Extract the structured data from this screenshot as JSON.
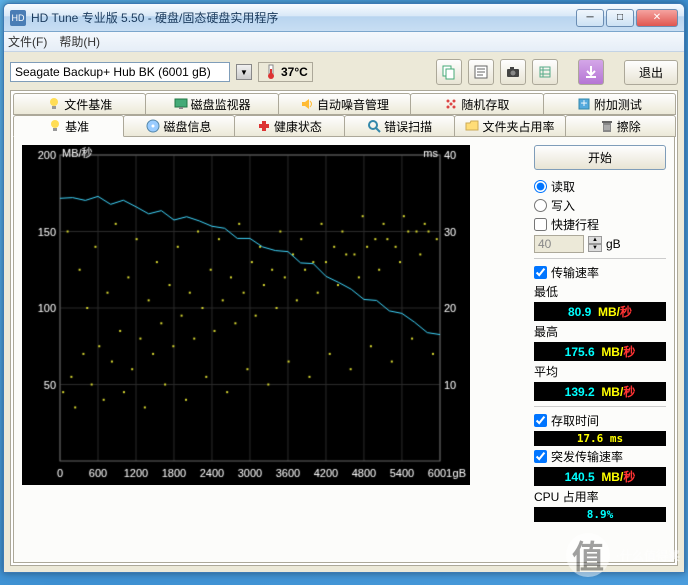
{
  "window": {
    "title": "HD Tune 专业版 5.50 - 硬盘/固态硬盘实用程序",
    "icon_letter": "HD"
  },
  "menu": {
    "file": "文件(F)",
    "help": "帮助(H)"
  },
  "toolbar": {
    "drive": "Seagate Backup+ Hub BK (6001 gB)",
    "temp": "37°C",
    "icons": {
      "copy": "copy-icon",
      "screenshot": "screenshot-icon",
      "camera": "camera-icon",
      "settings": "settings-icon",
      "down": "download-icon"
    },
    "exit": "退出"
  },
  "tabs_top": [
    {
      "label": "文件基准",
      "icon": "lightbulb"
    },
    {
      "label": "磁盘监视器",
      "icon": "monitor"
    },
    {
      "label": "自动噪音管理",
      "icon": "speaker"
    },
    {
      "label": "随机存取",
      "icon": "random"
    },
    {
      "label": "附加测试",
      "icon": "extra"
    }
  ],
  "tabs_mid": [
    {
      "label": "基准",
      "icon": "bulb",
      "active": true
    },
    {
      "label": "磁盘信息",
      "icon": "disk"
    },
    {
      "label": "健康状态",
      "icon": "health"
    },
    {
      "label": "错误扫描",
      "icon": "scan"
    },
    {
      "label": "文件夹占用率",
      "icon": "folder"
    },
    {
      "label": "擦除",
      "icon": "erase"
    }
  ],
  "side": {
    "start": "开始",
    "read": "读取",
    "write": "写入",
    "shortstroke": "快捷行程",
    "shortstroke_val": "40",
    "shortstroke_unit": "gB",
    "transfer": "传输速率",
    "min_label": "最低",
    "min_val": "80.9",
    "avg_label": "平均",
    "avg_val": "139.2",
    "max_label": "最高",
    "max_val": "175.6",
    "mb_unit": "MB/",
    "sec_unit": "秒",
    "access": "存取时间",
    "access_val": "17.6 ms",
    "burst": "突发传输速率",
    "burst_val": "140.5",
    "cpu": "CPU 占用率",
    "cpu_val": "8.9%"
  },
  "chart_data": {
    "type": "line+scatter",
    "title": "",
    "xlabel": "gB",
    "ylabel_left": "MB/秒",
    "ylabel_right": "ms",
    "xlim": [
      0,
      6001
    ],
    "ylim_left": [
      0,
      200
    ],
    "ylim_right": [
      0,
      40
    ],
    "xticks": [
      0,
      600,
      1200,
      1800,
      2400,
      3000,
      3600,
      4200,
      4800,
      5400,
      6001
    ],
    "yticks_left": [
      50,
      100,
      150,
      200
    ],
    "yticks_right": [
      10,
      20,
      30,
      40
    ],
    "series": [
      {
        "name": "transfer_rate",
        "type": "line",
        "color": "#3fd8ff",
        "y_axis": "left",
        "x": [
          0,
          200,
          400,
          600,
          800,
          1000,
          1200,
          1400,
          1600,
          1800,
          2000,
          2200,
          2400,
          2600,
          2800,
          3000,
          3200,
          3400,
          3600,
          3800,
          4000,
          4200,
          4400,
          4600,
          4800,
          5000,
          5200,
          5400,
          5600,
          5800,
          6001
        ],
        "y": [
          173,
          172,
          172,
          170,
          168,
          169,
          166,
          164,
          163,
          160,
          158,
          156,
          153,
          150,
          148,
          145,
          142,
          138,
          135,
          130,
          126,
          122,
          117,
          113,
          108,
          103,
          99,
          94,
          90,
          85,
          82
        ]
      },
      {
        "name": "access_time",
        "type": "scatter",
        "color": "#d8d830",
        "y_axis": "right",
        "x": [
          50,
          120,
          180,
          240,
          310,
          370,
          430,
          500,
          560,
          620,
          690,
          750,
          820,
          880,
          950,
          1010,
          1080,
          1140,
          1210,
          1270,
          1340,
          1400,
          1470,
          1530,
          1600,
          1660,
          1730,
          1790,
          1860,
          1920,
          1990,
          2050,
          2120,
          2180,
          2250,
          2310,
          2380,
          2440,
          2510,
          2570,
          2640,
          2700,
          2770,
          2830,
          2900,
          2960,
          3030,
          3090,
          3160,
          3220,
          3290,
          3350,
          3420,
          3480,
          3550,
          3610,
          3680,
          3740,
          3810,
          3870,
          3940,
          4000,
          4070,
          4130,
          4200,
          4260,
          4330,
          4390,
          4460,
          4520,
          4590,
          4650,
          4720,
          4780,
          4850,
          4910,
          4980,
          5040,
          5110,
          5170,
          5240,
          5300,
          5370,
          5430,
          5500,
          5560,
          5630,
          5690,
          5760,
          5820,
          5890,
          5950
        ],
        "y": [
          9,
          30,
          11,
          7,
          25,
          14,
          20,
          10,
          28,
          15,
          8,
          22,
          13,
          31,
          17,
          9,
          24,
          12,
          29,
          16,
          7,
          21,
          14,
          26,
          18,
          10,
          23,
          15,
          28,
          19,
          8,
          22,
          16,
          30,
          20,
          11,
          25,
          17,
          29,
          21,
          9,
          24,
          18,
          31,
          22,
          12,
          26,
          19,
          28,
          23,
          10,
          25,
          20,
          30,
          24,
          13,
          27,
          21,
          29,
          25,
          11,
          26,
          22,
          31,
          26,
          14,
          28,
          23,
          30,
          27,
          12,
          27,
          24,
          32,
          28,
          15,
          29,
          25,
          31,
          29,
          13,
          28,
          26,
          32,
          30,
          16,
          30,
          27,
          31,
          30,
          14,
          29
        ]
      }
    ]
  },
  "watermark": "值(·什么值得买"
}
